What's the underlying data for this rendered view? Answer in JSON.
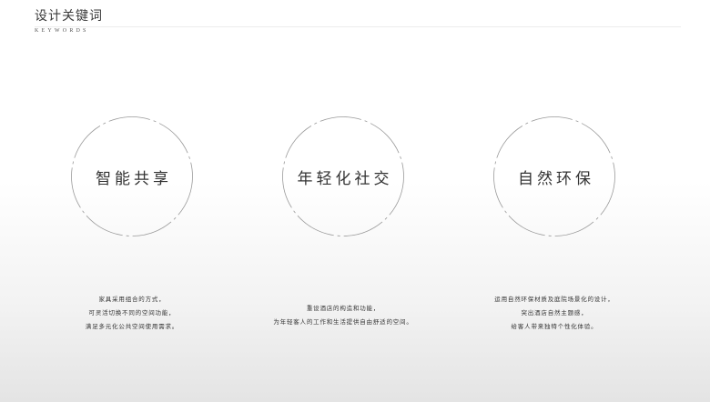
{
  "header": {
    "title": "设计关键词",
    "subtitle": "KEYWORDS"
  },
  "keywords": [
    {
      "label": "智能共享",
      "description": [
        "家具采用组合的方式，",
        "可灵活切换不同的空间功能，",
        "满足多元化公共空间使用需求。"
      ]
    },
    {
      "label": "年轻化社交",
      "description": [
        "重设酒店的构造和功能，",
        "为年轻客人的工作和生活提供自由舒适的空间。"
      ]
    },
    {
      "label": "自然环保",
      "description": [
        "运用自然环保材质及庭院场景化的设计，",
        "突出酒店自然主题感，",
        "给客人带来独特个性化体验。"
      ]
    }
  ],
  "colors": {
    "circle_stroke": "#9a9a9a",
    "text": "#333333"
  }
}
